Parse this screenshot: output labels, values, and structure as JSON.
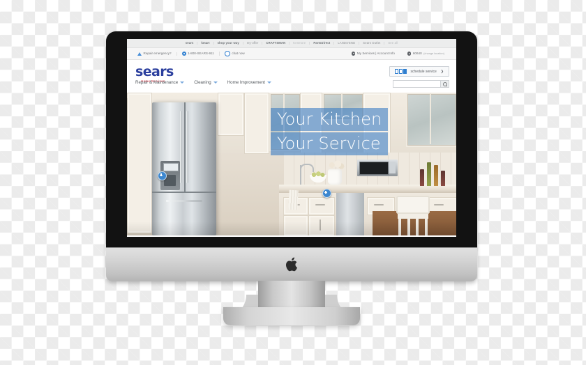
{
  "device": {
    "name": "iMac desktop computer mockup",
    "brand_logo": "apple-logo"
  },
  "site": {
    "brand_bar": [
      {
        "label": "sears",
        "style": "strong"
      },
      {
        "label": "kmart",
        "style": "strong"
      },
      {
        "label": "shop your way",
        "style": "strong"
      },
      {
        "label": "my·offer",
        "style": "normal"
      },
      {
        "label": "CRAFTSMAN",
        "style": "strong"
      },
      {
        "label": "Kenmore",
        "style": "faint"
      },
      {
        "label": "PartsDirect",
        "style": "strong"
      },
      {
        "label": "LANDS'END",
        "style": "normal"
      },
      {
        "label": "Sears Outlet",
        "style": "normal"
      },
      {
        "label": "See all",
        "style": "faint"
      }
    ],
    "utility_bar": {
      "repair_emergency": "Repair emergency?",
      "phone": "1-800-SEARS-911",
      "chat": "chat now",
      "my_services": "My Services | Account Info",
      "zip": "60640",
      "change_location": "(change location)"
    },
    "logo": {
      "word": "sears",
      "tagline": "Home Services",
      "word_color": "#2b3f9e",
      "tagline_color": "#cf2030"
    },
    "schedule_button": {
      "label": "schedule service",
      "arrow": "❯"
    },
    "nav": [
      {
        "label": "Repair & Maintenance"
      },
      {
        "label": "Cleaning"
      },
      {
        "label": "Home Improvement"
      }
    ],
    "search": {
      "value": "",
      "placeholder": ""
    },
    "hero": {
      "line1": "Your Kitchen",
      "line2": "Your Service",
      "band_color": "#4080c4",
      "text_color": "#ffffff",
      "hotspots": [
        {
          "label": "+",
          "target": "refrigerator"
        },
        {
          "label": "+",
          "target": "dishwasher"
        }
      ],
      "scene": "modern kitchen with stainless steel french-door refrigerator, white cabinetry, marble backsplash, microwave and island"
    }
  }
}
